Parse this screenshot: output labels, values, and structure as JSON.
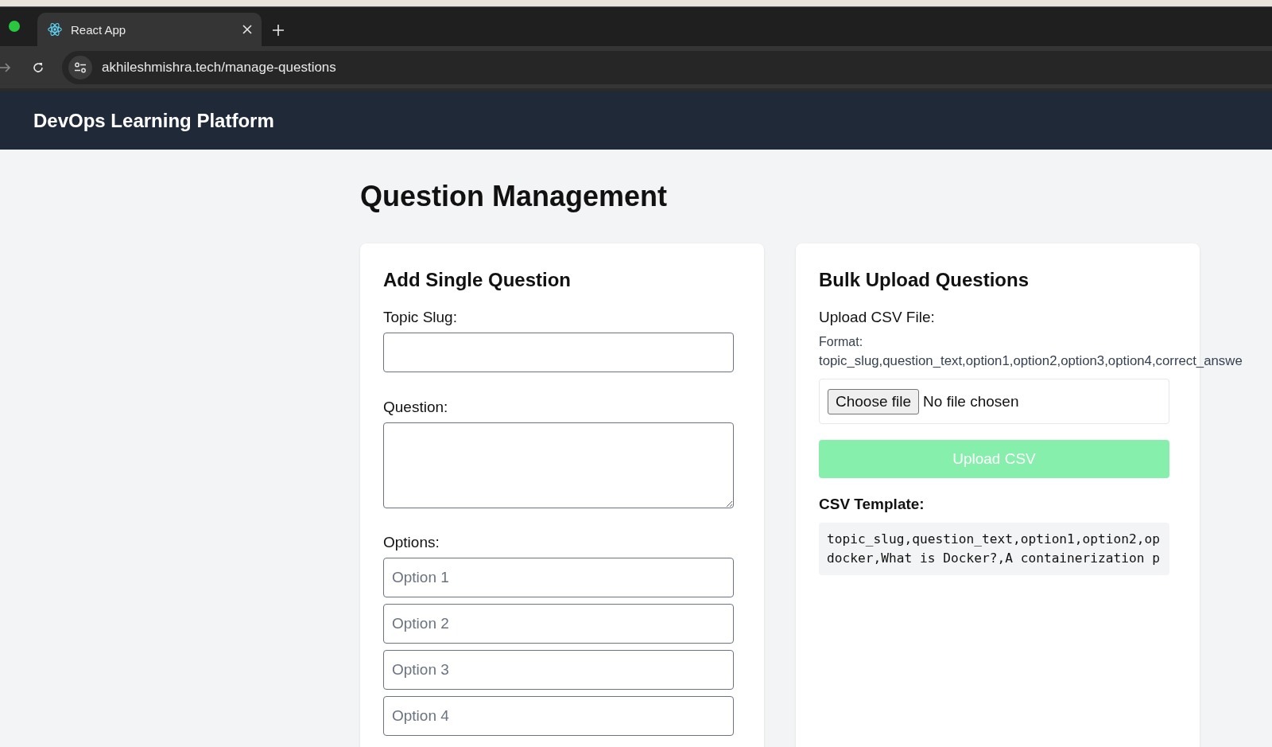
{
  "browser": {
    "tab": {
      "title": "React App"
    },
    "url": "akhileshmishra.tech/manage-questions"
  },
  "header": {
    "title": "DevOps Learning Platform"
  },
  "page": {
    "title": "Question Management"
  },
  "single_question": {
    "heading": "Add Single Question",
    "topic_label": "Topic Slug:",
    "question_label": "Question:",
    "options_label": "Options:",
    "options": [
      {
        "placeholder": "Option 1"
      },
      {
        "placeholder": "Option 2"
      },
      {
        "placeholder": "Option 3"
      },
      {
        "placeholder": "Option 4"
      }
    ]
  },
  "bulk_upload": {
    "heading": "Bulk Upload Questions",
    "file_label": "Upload CSV File:",
    "format_label": "Format:",
    "format_text": "topic_slug,question_text,option1,option2,option3,option4,correct_answe",
    "choose_button": "Choose file",
    "file_status": "No file chosen",
    "upload_button": {
      "label": "Upload CSV",
      "disabled": true
    },
    "template_heading": "CSV Template:",
    "template_lines": [
      "topic_slug,question_text,option1,option2,op",
      "docker,What is Docker?,A containerization p"
    ]
  }
}
